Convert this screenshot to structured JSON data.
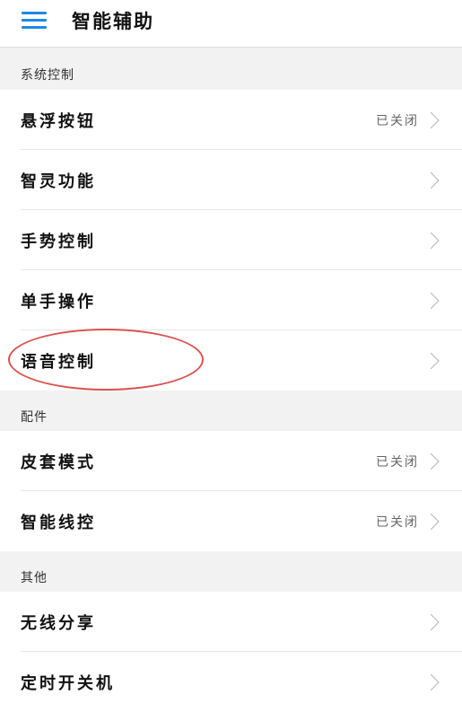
{
  "header": {
    "title": "智能辅助",
    "menu_icon": "menu-icon"
  },
  "sections": [
    {
      "label": "系统控制",
      "items": [
        {
          "label": "悬浮按钮",
          "status": "已关闭"
        },
        {
          "label": "智灵功能",
          "status": ""
        },
        {
          "label": "手势控制",
          "status": ""
        },
        {
          "label": "单手操作",
          "status": ""
        },
        {
          "label": "语音控制",
          "status": ""
        }
      ]
    },
    {
      "label": "配件",
      "items": [
        {
          "label": "皮套模式",
          "status": "已关闭"
        },
        {
          "label": "智能线控",
          "status": "已关闭"
        }
      ]
    },
    {
      "label": "其他",
      "items": [
        {
          "label": "无线分享",
          "status": ""
        },
        {
          "label": "定时开关机",
          "status": ""
        }
      ]
    }
  ],
  "colors": {
    "accent": "#1e88e5",
    "section_bg": "#f2f2f2",
    "highlight": "#d9534f"
  },
  "icons": {
    "chevron": "chevron-right-icon"
  }
}
